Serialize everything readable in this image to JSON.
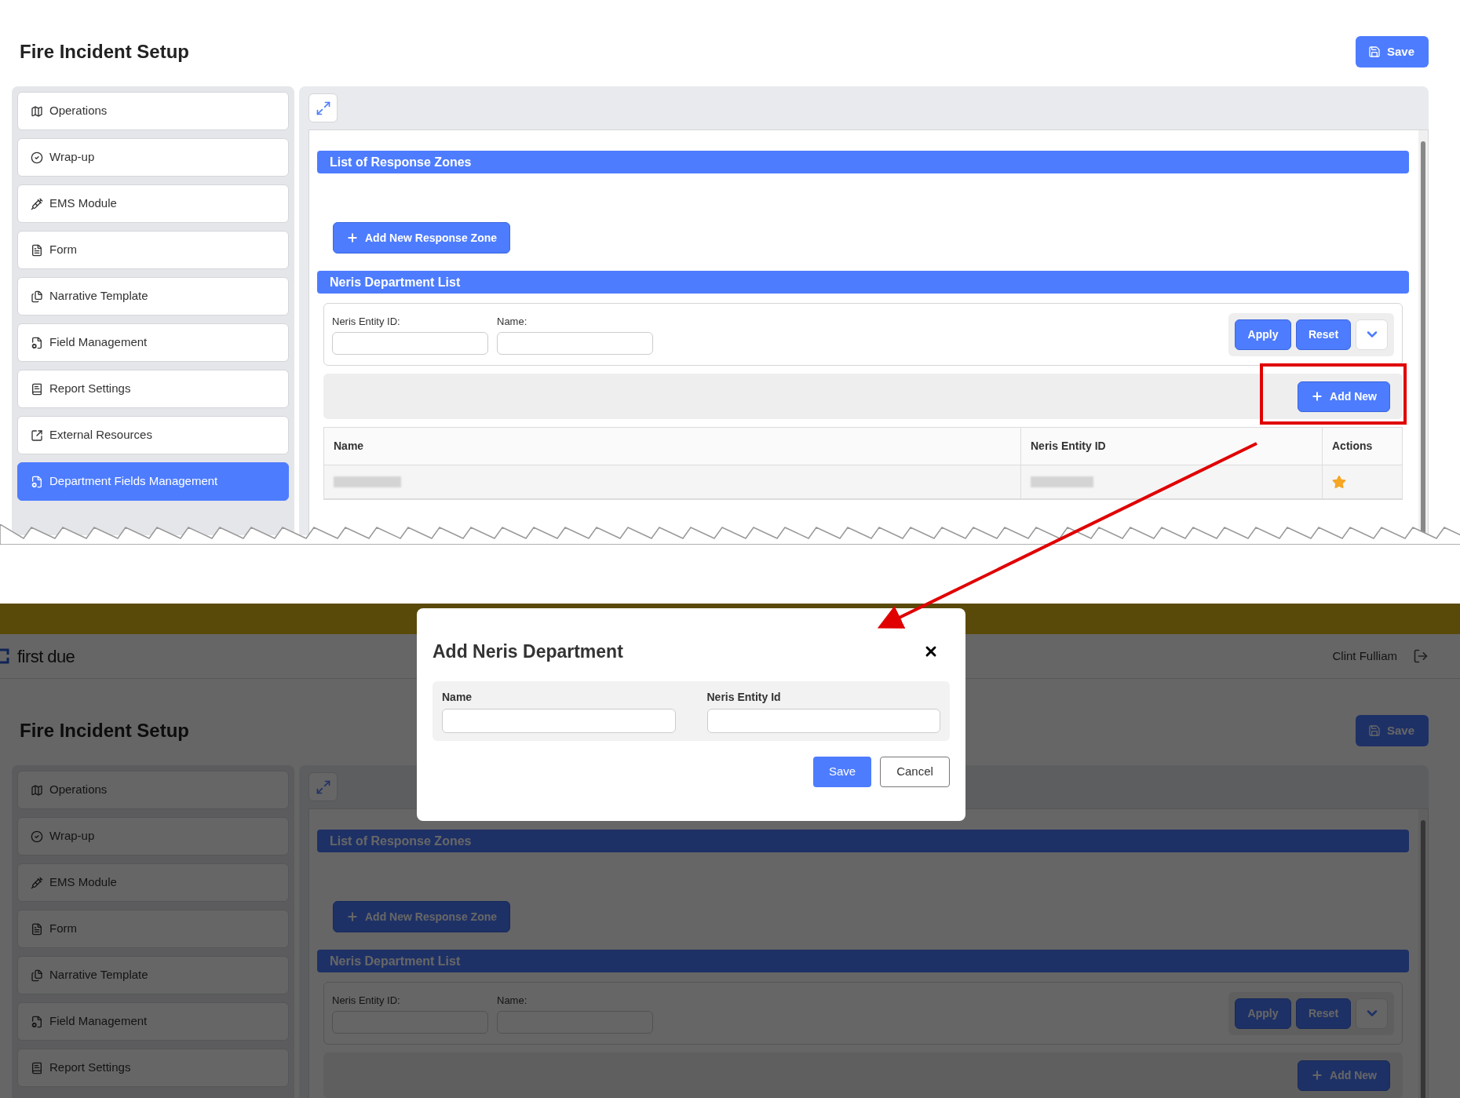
{
  "top_view": {
    "title": "Fire Incident Setup",
    "save_button": "Save",
    "sidebar": {
      "items": [
        {
          "label": "Operations",
          "kind": "map",
          "selected": false
        },
        {
          "label": "Wrap-up",
          "kind": "check",
          "selected": false
        },
        {
          "label": "EMS Module",
          "kind": "syringe",
          "selected": false
        },
        {
          "label": "Form",
          "kind": "doc",
          "selected": false
        },
        {
          "label": "Narrative Template",
          "kind": "docs",
          "selected": false
        },
        {
          "label": "Field Management",
          "kind": "settings",
          "selected": false
        },
        {
          "label": "Report Settings",
          "kind": "report",
          "selected": false
        },
        {
          "label": "External Resources",
          "kind": "external",
          "selected": false
        },
        {
          "label": "Department Fields Management",
          "kind": "settings",
          "selected": true
        }
      ]
    },
    "response_zones": {
      "title": "List of Response Zones",
      "add_button": "Add New Response Zone"
    },
    "neris": {
      "title": "Neris Department List",
      "filters": [
        {
          "label": "Neris Entity ID:"
        },
        {
          "label": "Name:"
        }
      ],
      "apply_button": "Apply",
      "reset_button": "Reset",
      "add_button": "Add New",
      "table": {
        "columns": [
          "Name",
          "Neris Entity ID",
          "Actions"
        ],
        "rows": [
          {
            "kind": "redacted"
          }
        ]
      }
    }
  },
  "bottom_view": {
    "header": {
      "logo": "first due",
      "user": "Clint Fulliam"
    },
    "title": "Fire Incident Setup",
    "save_button": "Save",
    "sidebar": {
      "items": [
        {
          "label": "Operations",
          "kind": "map",
          "selected": false
        },
        {
          "label": "Wrap-up",
          "kind": "check",
          "selected": false
        },
        {
          "label": "EMS Module",
          "kind": "syringe",
          "selected": false
        },
        {
          "label": "Form",
          "kind": "doc",
          "selected": false
        },
        {
          "label": "Narrative Template",
          "kind": "docs",
          "selected": false
        },
        {
          "label": "Field Management",
          "kind": "settings",
          "selected": false
        },
        {
          "label": "Report Settings",
          "kind": "report",
          "selected": false
        }
      ]
    },
    "response_zones": {
      "title": "List of Response Zones",
      "add_button": "Add New Response Zone"
    },
    "neris": {
      "title": "Neris Department List",
      "filters": [
        {
          "label": "Neris Entity ID:"
        },
        {
          "label": "Name:"
        }
      ],
      "apply_button": "Apply",
      "reset_button": "Reset",
      "add_button": "Add New"
    },
    "modal": {
      "title": "Add Neris Department",
      "fields": [
        {
          "label": "Name"
        },
        {
          "label": "Neris Entity Id"
        }
      ],
      "save_button": "Save",
      "cancel_button": "Cancel"
    }
  }
}
